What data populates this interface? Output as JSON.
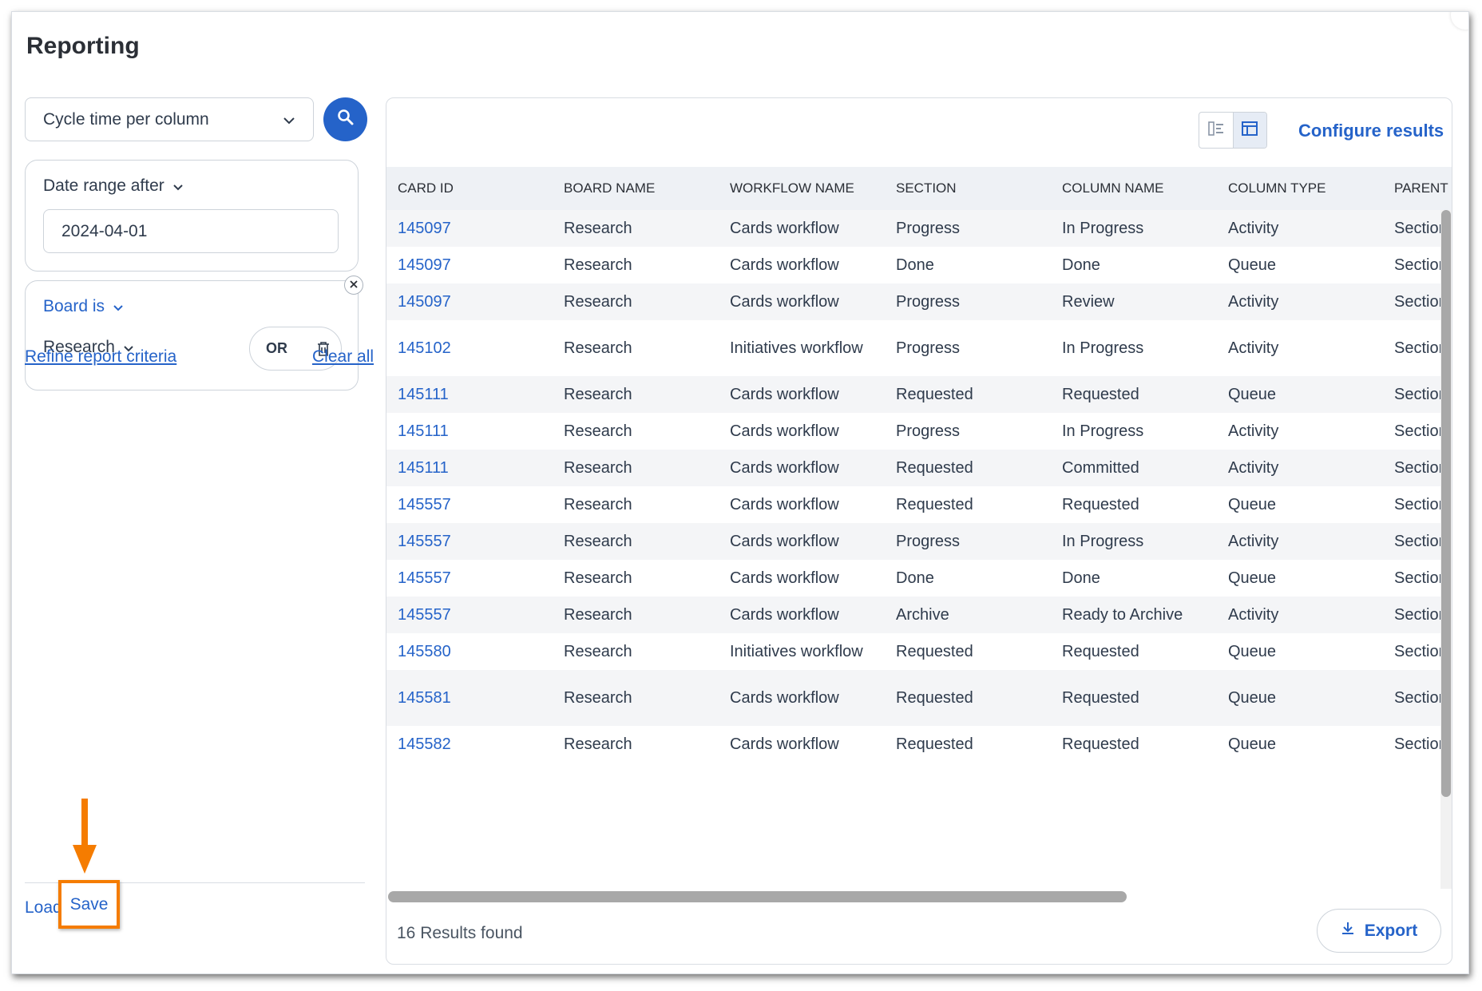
{
  "page": {
    "title": "Reporting"
  },
  "report_select": {
    "value": "Cycle time per column",
    "icon": "chevron-down-icon"
  },
  "search_button": {
    "icon": "search-icon"
  },
  "criteria": {
    "date": {
      "label": "Date range after",
      "value": "2024-04-01"
    },
    "board": {
      "label": "Board is",
      "value": "Research",
      "operator": "OR"
    }
  },
  "links": {
    "refine": "Refine report criteria",
    "clear": "Clear all"
  },
  "footer": {
    "load": "Load",
    "save": "Save"
  },
  "results": {
    "configure": "Configure results",
    "columns": [
      "CARD ID",
      "BOARD NAME",
      "WORKFLOW NAME",
      "SECTION",
      "COLUMN NAME",
      "COLUMN TYPE",
      "PARENT C"
    ],
    "rows": [
      {
        "card_id": "145097",
        "board": "Research",
        "workflow": "Cards workflow",
        "section": "Progress",
        "column": "In Progress",
        "type": "Activity",
        "parent": "Section"
      },
      {
        "card_id": "145097",
        "board": "Research",
        "workflow": "Cards workflow",
        "section": "Done",
        "column": "Done",
        "type": "Queue",
        "parent": "Section"
      },
      {
        "card_id": "145097",
        "board": "Research",
        "workflow": "Cards workflow",
        "section": "Progress",
        "column": "Review",
        "type": "Activity",
        "parent": "Section"
      },
      {
        "card_id": "145102",
        "board": "Research",
        "workflow": "Initiatives workflow",
        "section": "Progress",
        "column": "In Progress",
        "type": "Activity",
        "parent": "Section"
      },
      {
        "card_id": "145111",
        "board": "Research",
        "workflow": "Cards workflow",
        "section": "Requested",
        "column": "Requested",
        "type": "Queue",
        "parent": "Section"
      },
      {
        "card_id": "145111",
        "board": "Research",
        "workflow": "Cards workflow",
        "section": "Progress",
        "column": "In Progress",
        "type": "Activity",
        "parent": "Section"
      },
      {
        "card_id": "145111",
        "board": "Research",
        "workflow": "Cards workflow",
        "section": "Requested",
        "column": "Committed",
        "type": "Activity",
        "parent": "Section"
      },
      {
        "card_id": "145557",
        "board": "Research",
        "workflow": "Cards workflow",
        "section": "Requested",
        "column": "Requested",
        "type": "Queue",
        "parent": "Section"
      },
      {
        "card_id": "145557",
        "board": "Research",
        "workflow": "Cards workflow",
        "section": "Progress",
        "column": "In Progress",
        "type": "Activity",
        "parent": "Section"
      },
      {
        "card_id": "145557",
        "board": "Research",
        "workflow": "Cards workflow",
        "section": "Done",
        "column": "Done",
        "type": "Queue",
        "parent": "Section"
      },
      {
        "card_id": "145557",
        "board": "Research",
        "workflow": "Cards workflow",
        "section": "Archive",
        "column": "Ready to Archive",
        "type": "Activity",
        "parent": "Section"
      },
      {
        "card_id": "145580",
        "board": "Research",
        "workflow": "Initiatives workflow",
        "section": "Requested",
        "column": "Requested",
        "type": "Queue",
        "parent": "Section"
      },
      {
        "card_id": "145581",
        "board": "Research",
        "workflow": "Cards workflow",
        "section": "Requested",
        "column": "Requested",
        "type": "Queue",
        "parent": "Section"
      },
      {
        "card_id": "145582",
        "board": "Research",
        "workflow": "Cards workflow",
        "section": "Requested",
        "column": "Requested",
        "type": "Queue",
        "parent": "Section"
      }
    ],
    "count_text": "16 Results found",
    "export_label": "Export"
  },
  "colors": {
    "accent": "#2563c9",
    "highlight": "#f57c00",
    "header_bg": "#eef1f5",
    "stripe": "#f4f5f7"
  }
}
